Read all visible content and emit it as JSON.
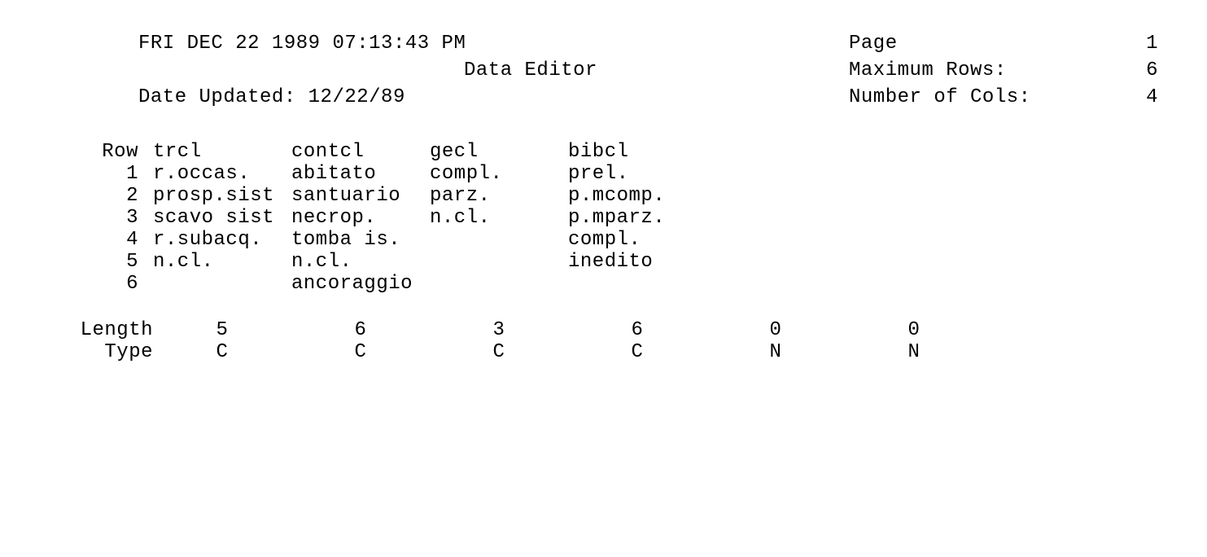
{
  "header": {
    "datetime": "FRI DEC 22  1989  07:13:43 PM",
    "title": "Data Editor",
    "updated_label": "Date Updated: 12/22/89",
    "page_label": "Page",
    "page_num": "1",
    "max_rows_label": "Maximum Rows:",
    "max_rows": "6",
    "num_cols_label": "Number of Cols:",
    "num_cols": "4"
  },
  "columns": [
    "trcl",
    "contcl",
    "gecl",
    "bibcl"
  ],
  "rows": [
    {
      "n": "Row",
      "c": [
        "trcl",
        "contcl",
        "gecl",
        "bibcl"
      ]
    },
    {
      "n": "1",
      "c": [
        "r.occas.",
        "abitato",
        "compl.",
        "prel."
      ]
    },
    {
      "n": "2",
      "c": [
        "prosp.sist",
        "santuario",
        "parz.",
        "p.mcomp."
      ]
    },
    {
      "n": "3",
      "c": [
        "scavo sist",
        "necrop.",
        "n.cl.",
        "p.mparz."
      ]
    },
    {
      "n": "4",
      "c": [
        "r.subacq.",
        "tomba is.",
        "",
        "compl."
      ]
    },
    {
      "n": "5",
      "c": [
        "n.cl.",
        "n.cl.",
        "",
        "inedito"
      ]
    },
    {
      "n": "6",
      "c": [
        "",
        "ancoraggio",
        "",
        ""
      ]
    }
  ],
  "footer": {
    "length_label": "Length",
    "type_label": "Type",
    "length": [
      "5",
      "6",
      "3",
      "6",
      "0",
      "0"
    ],
    "type": [
      "C",
      "C",
      "C",
      "C",
      "N",
      "N"
    ]
  }
}
